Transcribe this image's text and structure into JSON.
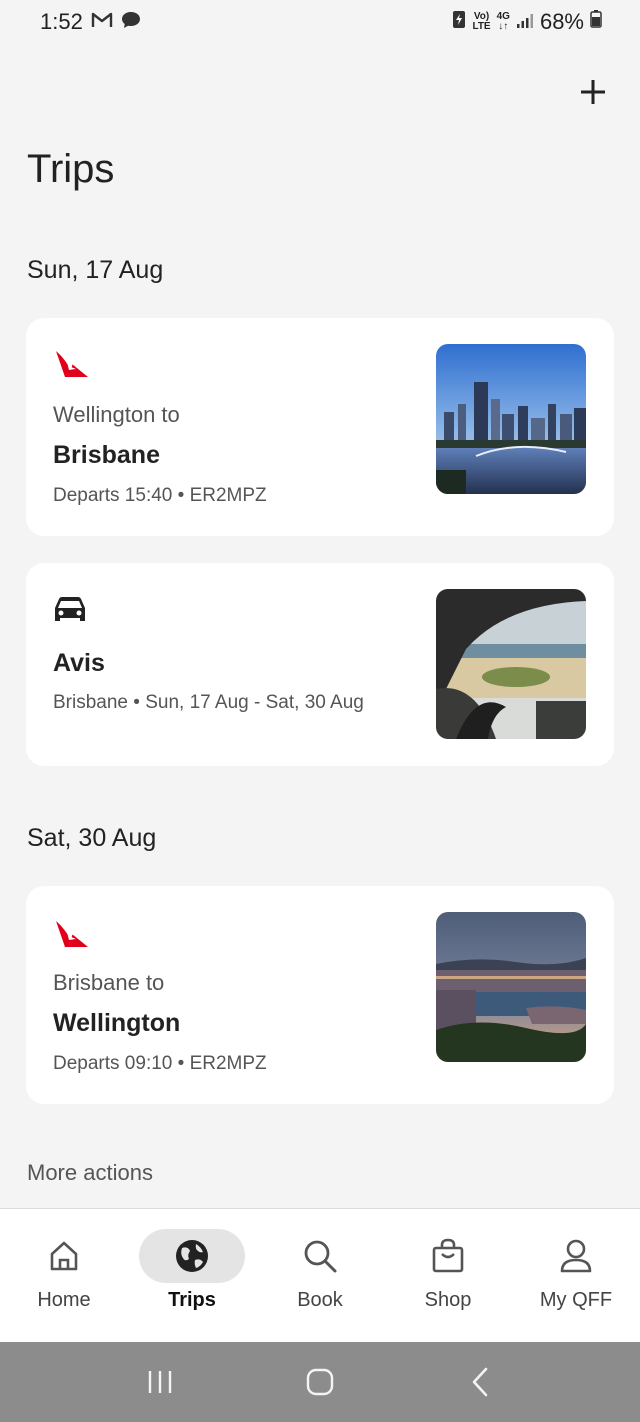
{
  "status_bar": {
    "time": "1:52",
    "volte_top": "Vo)",
    "volte_bottom": "LTE",
    "network": "4G",
    "battery": "68%"
  },
  "header": {
    "title": "Trips",
    "add_icon": "plus-icon"
  },
  "sections": [
    {
      "date": "Sun, 17 Aug",
      "cards": [
        {
          "type": "flight",
          "logo": "qantas-logo",
          "from": "Wellington to",
          "to": "Brisbane",
          "meta": "Departs 15:40 • ER2MPZ",
          "image": "brisbane-city-photo"
        },
        {
          "type": "car",
          "logo": "car-icon",
          "to": "Avis",
          "meta": "Brisbane • Sun, 17 Aug - Sat, 30 Aug",
          "image": "car-window-beach-photo"
        }
      ]
    },
    {
      "date": "Sat, 30 Aug",
      "cards": [
        {
          "type": "flight",
          "logo": "qantas-logo",
          "from": "Brisbane to",
          "to": "Wellington",
          "meta": "Departs 09:10 • ER2MPZ",
          "image": "wellington-harbour-photo"
        }
      ]
    }
  ],
  "more_actions": "More actions",
  "bottom_nav": [
    {
      "label": "Home",
      "icon": "home-icon",
      "active": false
    },
    {
      "label": "Trips",
      "icon": "globe-icon",
      "active": true
    },
    {
      "label": "Book",
      "icon": "search-icon",
      "active": false
    },
    {
      "label": "Shop",
      "icon": "shopping-bag-icon",
      "active": false
    },
    {
      "label": "My QFF",
      "icon": "person-icon",
      "active": false
    }
  ],
  "colors": {
    "background": "#f4f4f4",
    "card": "#ffffff",
    "qantas_red": "#e0001b",
    "system_nav": "#8c8c8c"
  }
}
